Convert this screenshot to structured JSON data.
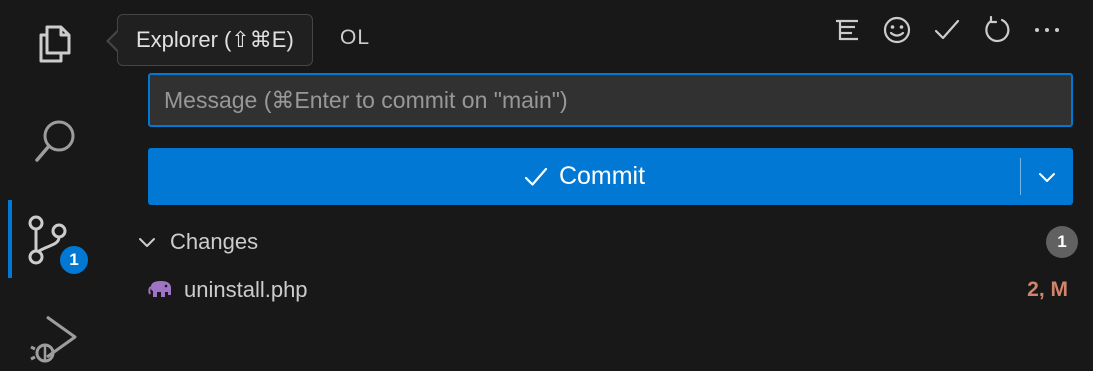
{
  "activity_bar": {
    "badge_count": "1"
  },
  "tooltip": {
    "text": "Explorer (⇧⌘E)"
  },
  "panel": {
    "title_fragment": "OL"
  },
  "commit": {
    "message_placeholder": "Message (⌘Enter to commit on \"main\")",
    "message_value": "",
    "button_label": "Commit"
  },
  "changes": {
    "label": "Changes",
    "count": "1",
    "files": [
      {
        "name": "uninstall.php",
        "status": "2, M"
      }
    ]
  },
  "colors": {
    "accent": "#0078d4",
    "background": "#181818",
    "file_status": "#d1846b",
    "php_icon": "#a074c4"
  }
}
